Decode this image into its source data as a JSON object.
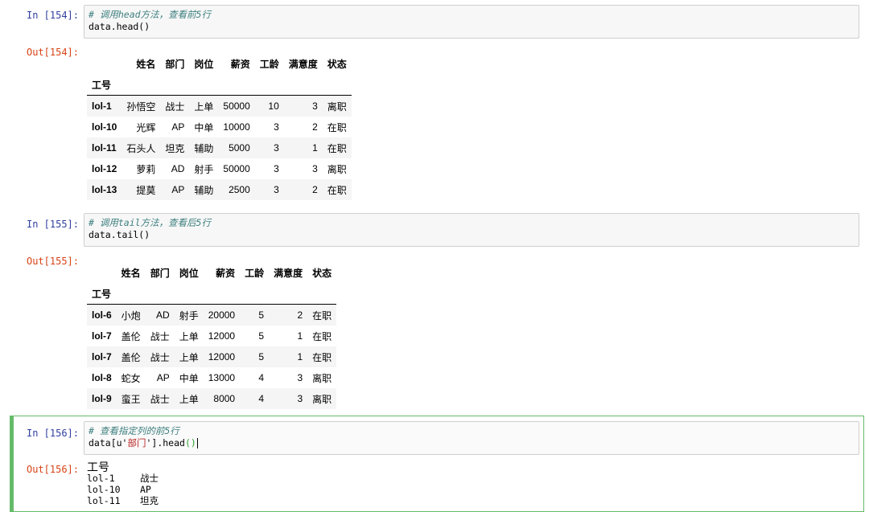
{
  "cells": [
    {
      "in_prompt": "In [154]:",
      "comment": "# 调用head方法，查看前5行",
      "code": "data.head()",
      "out_prompt": "Out[154]:",
      "table": {
        "columns": [
          "姓名",
          "部门",
          "岗位",
          "薪资",
          "工龄",
          "满意度",
          "状态"
        ],
        "index_name": "工号",
        "rows": [
          [
            "lol-1",
            "孙悟空",
            "战士",
            "上单",
            "50000",
            "10",
            "3",
            "离职"
          ],
          [
            "lol-10",
            "光辉",
            "AP",
            "中单",
            "10000",
            "3",
            "2",
            "在职"
          ],
          [
            "lol-11",
            "石头人",
            "坦克",
            "辅助",
            "5000",
            "3",
            "1",
            "在职"
          ],
          [
            "lol-12",
            "萝莉",
            "AD",
            "射手",
            "50000",
            "3",
            "3",
            "离职"
          ],
          [
            "lol-13",
            "提莫",
            "AP",
            "辅助",
            "2500",
            "3",
            "2",
            "在职"
          ]
        ]
      }
    },
    {
      "in_prompt": "In [155]:",
      "comment": "# 调用tail方法，查看后5行",
      "code": "data.tail()",
      "out_prompt": "Out[155]:",
      "table": {
        "columns": [
          "姓名",
          "部门",
          "岗位",
          "薪资",
          "工龄",
          "满意度",
          "状态"
        ],
        "index_name": "工号",
        "rows": [
          [
            "lol-6",
            "小炮",
            "AD",
            "射手",
            "20000",
            "5",
            "2",
            "在职"
          ],
          [
            "lol-7",
            "盖伦",
            "战士",
            "上单",
            "12000",
            "5",
            "1",
            "在职"
          ],
          [
            "lol-7",
            "盖伦",
            "战士",
            "上单",
            "12000",
            "5",
            "1",
            "在职"
          ],
          [
            "lol-8",
            "蛇女",
            "AP",
            "中单",
            "13000",
            "4",
            "3",
            "离职"
          ],
          [
            "lol-9",
            "蛮王",
            "战士",
            "上单",
            "8000",
            "4",
            "3",
            "离职"
          ]
        ]
      }
    },
    {
      "in_prompt": "In [156]:",
      "comment": "# 查看指定列的前5行",
      "code_prefix": "data[u'",
      "code_string": "部门",
      "code_suffix": "'].head",
      "code_parens": "()",
      "out_prompt": "Out[156]:",
      "series": {
        "index_name": "工号",
        "rows": [
          [
            "lol-1",
            "战士"
          ],
          [
            "lol-10",
            "AP"
          ],
          [
            "lol-11",
            "坦克"
          ]
        ]
      }
    }
  ]
}
